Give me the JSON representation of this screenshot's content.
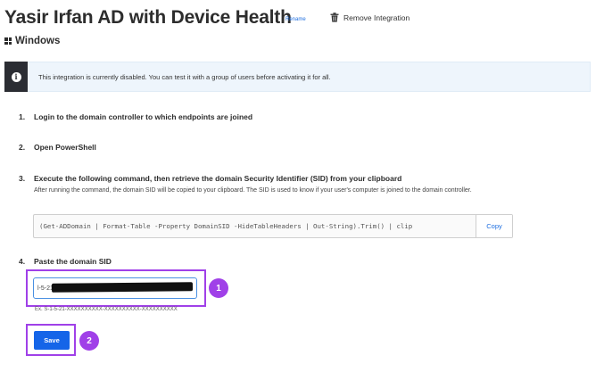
{
  "header": {
    "title": "Yasir Irfan AD with Device Health",
    "rename_label": "Rename",
    "remove_label": "Remove Integration",
    "os_label": "Windows"
  },
  "banner": {
    "text": "This integration is currently disabled. You can test it with a group of users before activating it for all."
  },
  "steps": [
    {
      "number": "1.",
      "text": "Login to the domain controller to which endpoints are joined"
    },
    {
      "number": "2.",
      "text": "Open PowerShell"
    },
    {
      "number": "3.",
      "text": "Execute the following command, then retrieve the domain Security Identifier (SID) from your clipboard",
      "subtext": "After running the command, the domain SID will be copied to your clipboard. The SID is used to know if your user's computer is joined to the domain controller."
    },
    {
      "number": "4.",
      "text": "Paste the domain SID"
    }
  ],
  "command": {
    "text": "(Get-ADDomain | Format-Table -Property DomainSID -HideTableHeaders | Out-String).Trim() | clip",
    "copy_label": "Copy"
  },
  "sid_field": {
    "value": "l-5-21-",
    "example": "Ex. S-1-5-21-XXXXXXXXXX-XXXXXXXXXX-XXXXXXXXXX"
  },
  "save_label": "Save",
  "annotations": {
    "badge_1": "1",
    "badge_2": "2",
    "highlight_color": "#a040e8"
  },
  "colors": {
    "accent": "#1565e8",
    "banner_bg": "#eef5fc",
    "banner_strip": "#2b2d33"
  },
  "icons": {
    "remove": "trash-icon",
    "os": "windows-logo-icon",
    "banner": "info-icon"
  }
}
